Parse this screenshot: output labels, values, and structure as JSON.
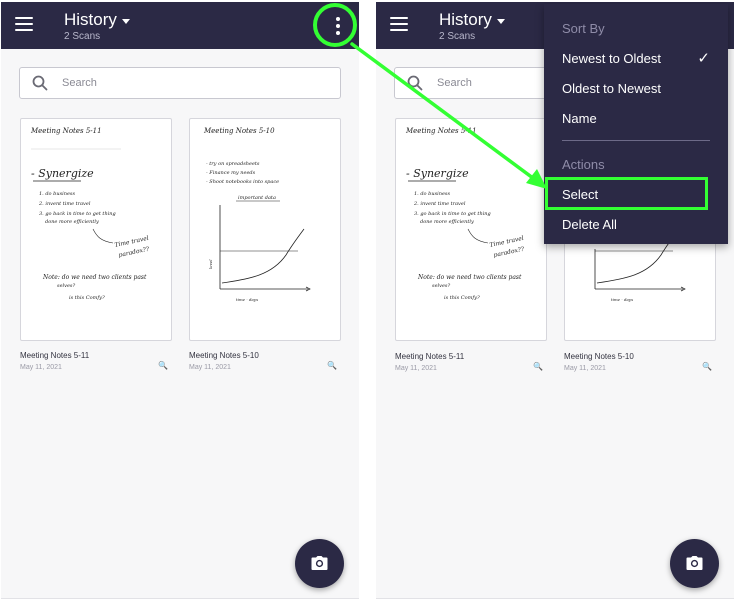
{
  "app": {
    "title": "History",
    "subtitle": "2 Scans"
  },
  "search": {
    "placeholder": "Search"
  },
  "scans": [
    {
      "name": "Meeting Notes 5-11",
      "date": "May 11, 2021",
      "sheet_title": "Meeting Notes 5-11"
    },
    {
      "name": "Meeting Notes 5-10",
      "date": "May 11, 2021",
      "sheet_title": "Meeting Notes 5-10"
    }
  ],
  "menu": {
    "sort_header": "Sort By",
    "sort_newest": "Newest to Oldest",
    "sort_oldest": "Oldest to Newest",
    "sort_name": "Name",
    "selected_check": "✓",
    "actions_header": "Actions",
    "select": "Select",
    "delete_all": "Delete All"
  },
  "icons": {
    "menu": "hamburger-menu-icon",
    "overflow": "more-vertical-icon",
    "search": "search-icon",
    "zoom": "magnify-icon",
    "camera": "camera-icon",
    "check": "check-icon"
  },
  "colors": {
    "appbar": "#2b2945",
    "menu_background": "#2b2945",
    "highlight": "#33ff33",
    "background": "#f7f7f8"
  }
}
